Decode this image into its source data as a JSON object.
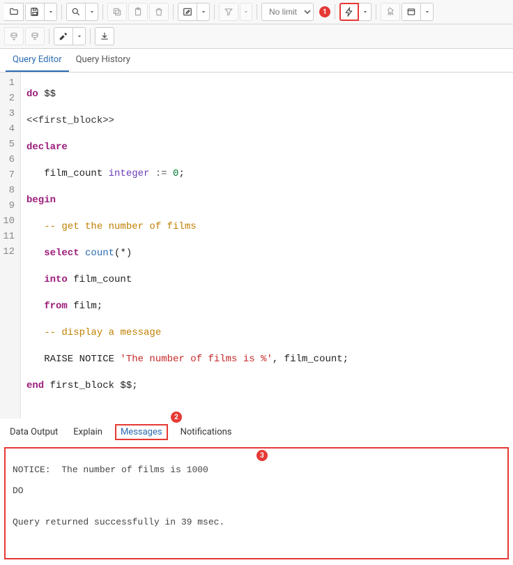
{
  "toolbar": {
    "limit_label": "No limit"
  },
  "editor_tabs": {
    "query_editor": "Query Editor",
    "query_history": "Query History"
  },
  "code": {
    "lines": [
      "1",
      "2",
      "3",
      "4",
      "5",
      "6",
      "7",
      "8",
      "9",
      "10",
      "11",
      "12"
    ],
    "l1_do": "do",
    "l1_dollar": " $$",
    "l2_label": "<<first_block>>",
    "l3_declare": "declare",
    "l4_ident": "   film_count ",
    "l4_type": "integer",
    "l4_rest": " := ",
    "l4_num": "0",
    "l4_semi": ";",
    "l5_begin": "begin",
    "l6_comment": "   -- get the number of films",
    "l7_select": "   select",
    "l7_count": " count",
    "l7_paren": "(*)",
    "l8_into": "   into",
    "l8_rest": " film_count",
    "l9_from": "   from",
    "l9_rest": " film;",
    "l10_comment": "   -- display a message",
    "l11_raise": "   RAISE NOTICE ",
    "l11_str": "'The number of films is %'",
    "l11_rest": ", film_count;",
    "l12_end": "end",
    "l12_rest": " first_block $$;"
  },
  "result_tabs": {
    "data_output": "Data Output",
    "explain": "Explain",
    "messages": "Messages",
    "notifications": "Notifications"
  },
  "messages": {
    "line1": "NOTICE:  The number of films is 1000",
    "line2": "DO",
    "line3": "",
    "line4": "Query returned successfully in 39 msec."
  },
  "callouts": {
    "c1": "1",
    "c2": "2",
    "c3": "3"
  }
}
